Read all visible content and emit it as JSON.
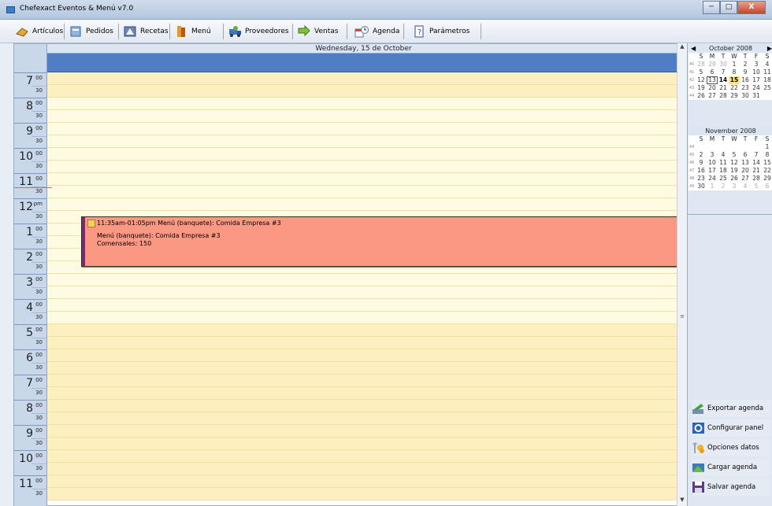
{
  "window": {
    "title": "Chefexact Eventos & Menú v7.0",
    "minimize": "─",
    "maximize": "□",
    "close": "X"
  },
  "toolbar": {
    "items": [
      {
        "label": "Artículos",
        "icon": "articulos-icon"
      },
      {
        "label": "Pedidos",
        "icon": "pedidos-icon"
      },
      {
        "label": "Recetas",
        "icon": "recetas-icon"
      },
      {
        "label": "Menú",
        "icon": "menu-icon"
      },
      {
        "label": "Proveedores",
        "icon": "proveedores-icon"
      },
      {
        "label": "Ventas",
        "icon": "ventas-icon"
      },
      {
        "label": "Agenda",
        "icon": "agenda-icon"
      },
      {
        "label": "Parámetros",
        "icon": "parametros-icon"
      }
    ]
  },
  "dayview": {
    "date_header": "Wednesday, 15 de October",
    "hours": [
      {
        "n": "7",
        "m": "00",
        "h": "30"
      },
      {
        "n": "8",
        "m": "00",
        "h": "30"
      },
      {
        "n": "9",
        "m": "00",
        "h": "30"
      },
      {
        "n": "10",
        "m": "00",
        "h": "30"
      },
      {
        "n": "11",
        "m": "00",
        "h": "30"
      },
      {
        "n": "12",
        "m": "pm",
        "h": "30"
      },
      {
        "n": "1",
        "m": "00",
        "h": "30"
      },
      {
        "n": "2",
        "m": "00",
        "h": "30"
      },
      {
        "n": "3",
        "m": "00",
        "h": "30"
      },
      {
        "n": "4",
        "m": "00",
        "h": "30"
      },
      {
        "n": "5",
        "m": "00",
        "h": "30"
      },
      {
        "n": "6",
        "m": "00",
        "h": "30"
      },
      {
        "n": "7",
        "m": "00",
        "h": "30"
      },
      {
        "n": "8",
        "m": "00",
        "h": "30"
      },
      {
        "n": "9",
        "m": "00",
        "h": "30"
      },
      {
        "n": "10",
        "m": "00",
        "h": "30"
      },
      {
        "n": "11",
        "m": "00",
        "h": "30"
      }
    ],
    "appointment": {
      "title": "11:35am-01:05pm Menú (banquete): Comida Empresa #3",
      "line1": "Menú (banquete): Comida Empresa #3",
      "line2": "Comensales: 150",
      "color": "#fa9884"
    }
  },
  "scrollbar": {
    "up": "▲",
    "down": "▼",
    "thumb": "≡"
  },
  "minical": [
    {
      "title": "October 2008",
      "prev": "◀",
      "next": "▶",
      "dow": [
        "S",
        "M",
        "T",
        "W",
        "T",
        "F",
        "S"
      ],
      "weeks": [
        {
          "wk": "40",
          "days": [
            "28",
            "29",
            "30",
            "1",
            "2",
            "3",
            "4"
          ]
        },
        {
          "wk": "41",
          "days": [
            "5",
            "6",
            "7",
            "8",
            "9",
            "10",
            "11"
          ]
        },
        {
          "wk": "42",
          "days": [
            "12",
            "13",
            "14",
            "15",
            "16",
            "17",
            "18"
          ]
        },
        {
          "wk": "43",
          "days": [
            "19",
            "20",
            "21",
            "22",
            "23",
            "24",
            "25"
          ]
        },
        {
          "wk": "44",
          "days": [
            "26",
            "27",
            "28",
            "29",
            "30",
            "31",
            ""
          ]
        }
      ]
    },
    {
      "title": "November 2008",
      "dow": [
        "S",
        "M",
        "T",
        "W",
        "T",
        "F",
        "S"
      ],
      "weeks": [
        {
          "wk": "44",
          "days": [
            "",
            "",
            "",
            "",
            "",
            "",
            "1"
          ]
        },
        {
          "wk": "45",
          "days": [
            "2",
            "3",
            "4",
            "5",
            "6",
            "7",
            "8"
          ]
        },
        {
          "wk": "46",
          "days": [
            "9",
            "10",
            "11",
            "12",
            "13",
            "14",
            "15"
          ]
        },
        {
          "wk": "47",
          "days": [
            "16",
            "17",
            "18",
            "19",
            "20",
            "21",
            "22"
          ]
        },
        {
          "wk": "48",
          "days": [
            "23",
            "24",
            "25",
            "26",
            "27",
            "28",
            "29"
          ]
        },
        {
          "wk": "49",
          "days": [
            "30",
            "1",
            "2",
            "3",
            "4",
            "5",
            "6"
          ]
        }
      ]
    }
  ],
  "side_buttons": [
    {
      "label": "Exportar agenda",
      "icon": "export-icon"
    },
    {
      "label": "Configurar panel",
      "icon": "configure-icon"
    },
    {
      "label": "Opciones datos",
      "icon": "options-icon"
    },
    {
      "label": "Cargar agenda",
      "icon": "load-icon"
    },
    {
      "label": "Salvar agenda",
      "icon": "save-icon"
    }
  ]
}
